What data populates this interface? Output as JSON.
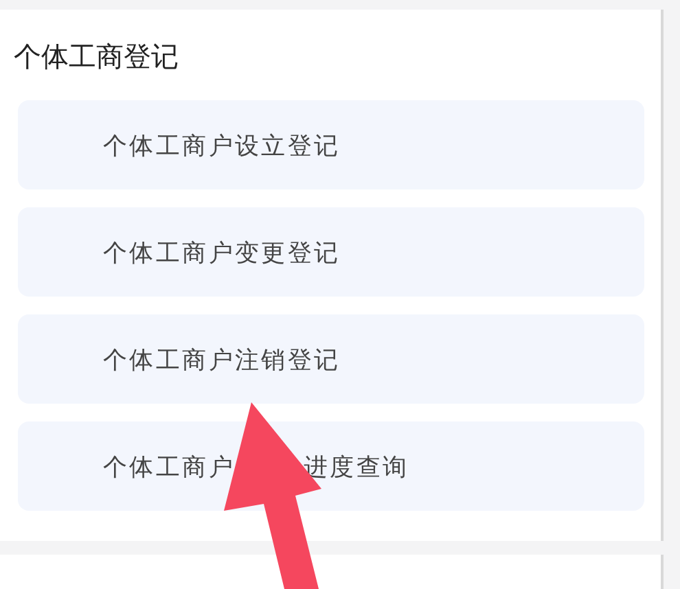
{
  "section": {
    "title": "个体工商登记",
    "items": [
      {
        "texts": [
          "个体工商户设立登记"
        ]
      },
      {
        "texts": [
          "个体工商户变更登记"
        ]
      },
      {
        "texts": [
          "个体工商户注销登记"
        ]
      },
      {
        "texts": [
          "个体工商户",
          "进度查询"
        ]
      }
    ]
  }
}
